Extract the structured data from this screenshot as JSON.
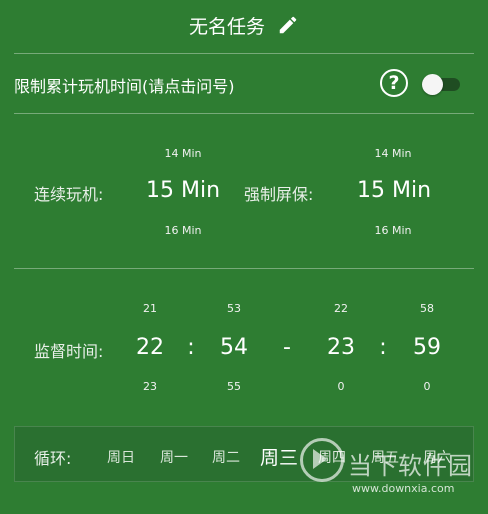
{
  "header": {
    "title": "无名任务",
    "edit_icon": "pencil-icon"
  },
  "limit": {
    "label": "限制累计玩机时间(请点击问号)",
    "help_icon_text": "?",
    "toggle_on": false
  },
  "play": {
    "label": "连续玩机:",
    "prev": "14 Min",
    "value": "15 Min",
    "next": "16 Min"
  },
  "lock": {
    "label": "强制屏保:",
    "prev": "14 Min",
    "value": "15 Min",
    "next": "16 Min"
  },
  "supervise": {
    "label": "监督时间:",
    "start_hour": {
      "prev": "21",
      "value": "22",
      "next": "23"
    },
    "start_min": {
      "prev": "53",
      "value": "54",
      "next": "55"
    },
    "end_hour": {
      "prev": "22",
      "value": "23",
      "next": "0"
    },
    "end_min": {
      "prev": "58",
      "value": "59",
      "next": "0"
    },
    "colon": ":",
    "dash": "-"
  },
  "cycle": {
    "label": "循环:",
    "days": [
      "周日",
      "周一",
      "周二",
      "周三",
      "周四",
      "周五",
      "周六"
    ],
    "selected": "周三"
  },
  "watermark": {
    "text": "当下软件园",
    "url": "www.downxia.com"
  }
}
